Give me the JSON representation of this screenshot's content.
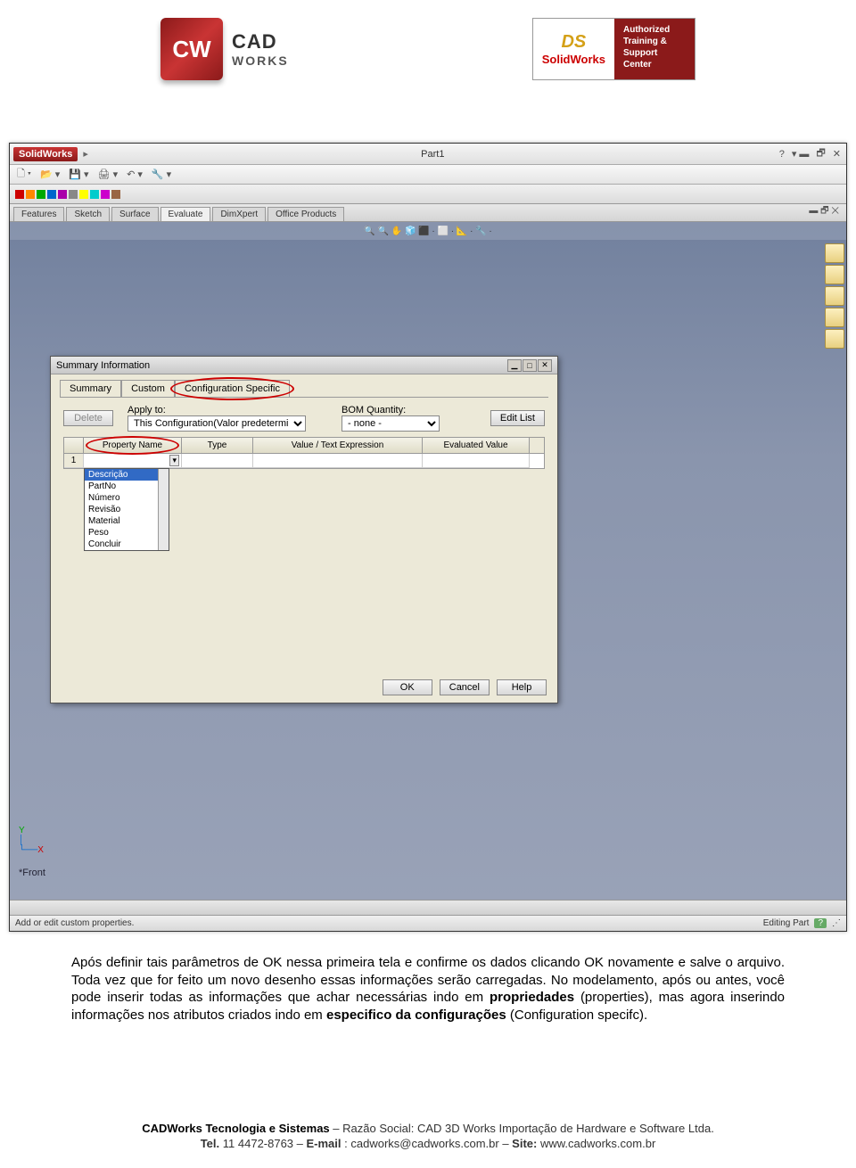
{
  "header": {
    "cadworks_initials": "CW",
    "cadworks_name": "CAD",
    "cadworks_sub": "WORKS",
    "sw_ds": "DS",
    "sw_name": "SolidWorks",
    "sw_badge": "Authorized Training & Support Center"
  },
  "app": {
    "brand": "SolidWorks",
    "doc_title": "Part1",
    "help_menu": "?",
    "tabs": [
      "Features",
      "Sketch",
      "Surface",
      "Evaluate",
      "DimXpert",
      "Office Products"
    ],
    "active_tab": "Evaluate",
    "view_toolbar": "🔍 🔍 ✋ 🧊 ⬛ · ⬜ · 📐 · 🔧 ·",
    "status_left": "Add or edit custom properties.",
    "status_right": "Editing Part",
    "view_label": "*Front"
  },
  "dialog": {
    "title": "Summary Information",
    "tabs": [
      "Summary",
      "Custom",
      "Configuration Specific"
    ],
    "active_tab": "Configuration Specific",
    "delete": "Delete",
    "apply_to_label": "Apply to:",
    "apply_to_value": "This Configuration(Valor predetermina",
    "bom_label": "BOM Quantity:",
    "bom_value": "- none -",
    "edit_list": "Edit List",
    "grid_headers": {
      "name": "Property Name",
      "type": "Type",
      "value": "Value / Text Expression",
      "eval": "Evaluated Value"
    },
    "row1": "1",
    "dropdown_items": [
      "Descrição",
      "PartNo",
      "Número",
      "Revisão",
      "Material",
      "Peso",
      "Concluir"
    ],
    "dropdown_selected": "Descrição",
    "buttons": {
      "ok": "OK",
      "cancel": "Cancel",
      "help": "Help"
    }
  },
  "body": {
    "p1a": "Após definir tais parâmetros de OK nessa primeira tela e confirme os dados clicando OK novamente e salve o arquivo. Toda vez que for feito um novo desenho essas informações serão carregadas. No modelamento, após ou antes, você pode inserir todas as informações que achar necessárias indo em ",
    "p1b": "propriedades",
    "p1c": "(properties), mas agora inserindo informações nos atributos criados indo em ",
    "p1d": "especifico da configurações ",
    "p1e": "(Configuration specifc)."
  },
  "footer": {
    "company_bold": "CADWorks Tecnologia e Sistemas",
    "company_rest": " – Razão Social: CAD 3D Works Importação de Hardware e Software Ltda.",
    "tel_label": "Tel.",
    "tel": " 11 4472-8763 – ",
    "email_label": "E-mail",
    "email": ": cadworks@cadworks.com.br – ",
    "site_label": "Site:",
    "site": " www.cadworks.com.br"
  }
}
